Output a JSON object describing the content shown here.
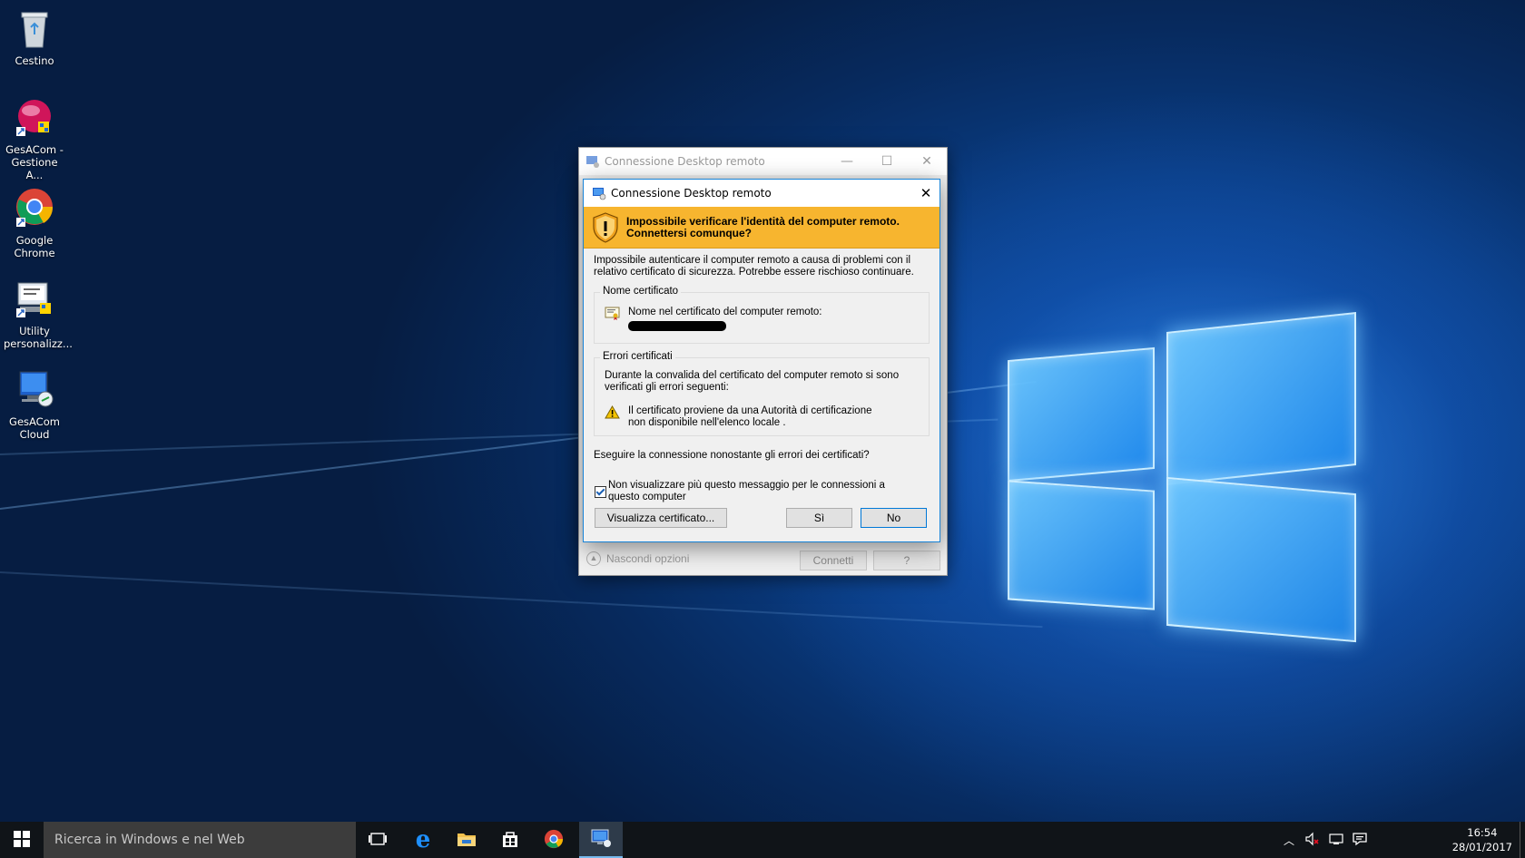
{
  "desktop": {
    "icons": [
      {
        "label": "Cestino",
        "icon": "recycle-bin-icon"
      },
      {
        "label": "GesACom - Gestione A...",
        "icon": "gesacom-icon"
      },
      {
        "label": "Google Chrome",
        "icon": "chrome-icon"
      },
      {
        "label": "Utility personalizz...",
        "icon": "utility-icon"
      },
      {
        "label": "GesACom Cloud",
        "icon": "remote-desktop-icon"
      }
    ]
  },
  "outer_window": {
    "title": "Connessione Desktop remoto",
    "hide_options": "Nascondi opzioni",
    "connect": "Connetti",
    "help": "?"
  },
  "dialog": {
    "title": "Connessione Desktop remoto",
    "warning_title": "Impossibile verificare l'identità del computer remoto. Connettersi comunque?",
    "intro": "Impossibile autenticare il computer remoto a causa di problemi con il relativo certificato di sicurezza. Potrebbe essere rischioso continuare.",
    "cert_group": {
      "label": "Nome certificato",
      "field_label": "Nome nel certificato del computer remoto:"
    },
    "errors_group": {
      "label": "Errori certificati",
      "description": "Durante la convalida del certificato del computer remoto si sono verificati gli errori seguenti:",
      "error": "Il certificato proviene da una Autorità di certificazione non disponibile nell'elenco locale ."
    },
    "question": "Eseguire la connessione nonostante gli errori dei certificati?",
    "dont_show": {
      "label": "Non visualizzare più questo messaggio per le connessioni a questo computer",
      "checked": true
    },
    "buttons": {
      "view_cert": "Visualizza certificato...",
      "yes": "Sì",
      "no": "No"
    },
    "banner_color": "#f7b52f"
  },
  "taskbar": {
    "search_placeholder": "Ricerca in Windows e nel Web",
    "time": "16:54",
    "date": "28/01/2017",
    "accent": "#76b9ed"
  }
}
